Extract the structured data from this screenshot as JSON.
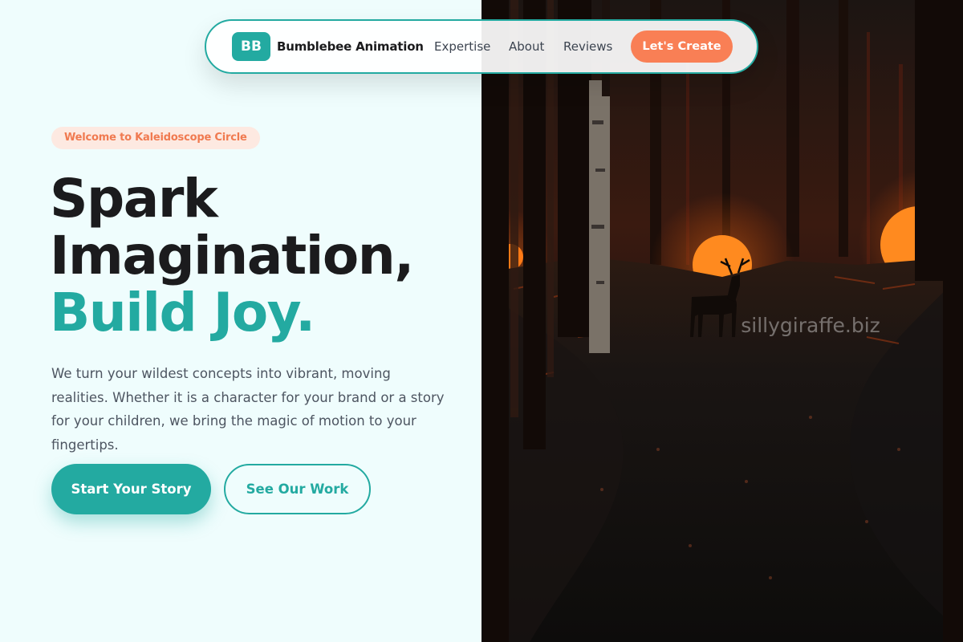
{
  "nav": {
    "logo_text": "BB",
    "brand": "Bumblebee Animation",
    "links": [
      "Expertise",
      "About",
      "Reviews"
    ],
    "cta": "Let's Create"
  },
  "hero": {
    "pill": "Welcome to Kaleidoscope Circle",
    "headline_line1": "Spark",
    "headline_line2": "Imagination,",
    "headline_accent": "Build Joy.",
    "description": "We turn your wildest concepts into vibrant, moving realities. Whether it is a character for your brand or a story for your children, we bring the magic of motion to your fingertips.",
    "primary_button": "Start Your Story",
    "secondary_button": "See Our Work"
  },
  "image": {
    "watermark": "sillygiraffe.biz"
  },
  "colors": {
    "accent": "#23aaa1",
    "cta": "#f97f55",
    "background": "#effdfd",
    "heading": "#1b1b1d"
  }
}
